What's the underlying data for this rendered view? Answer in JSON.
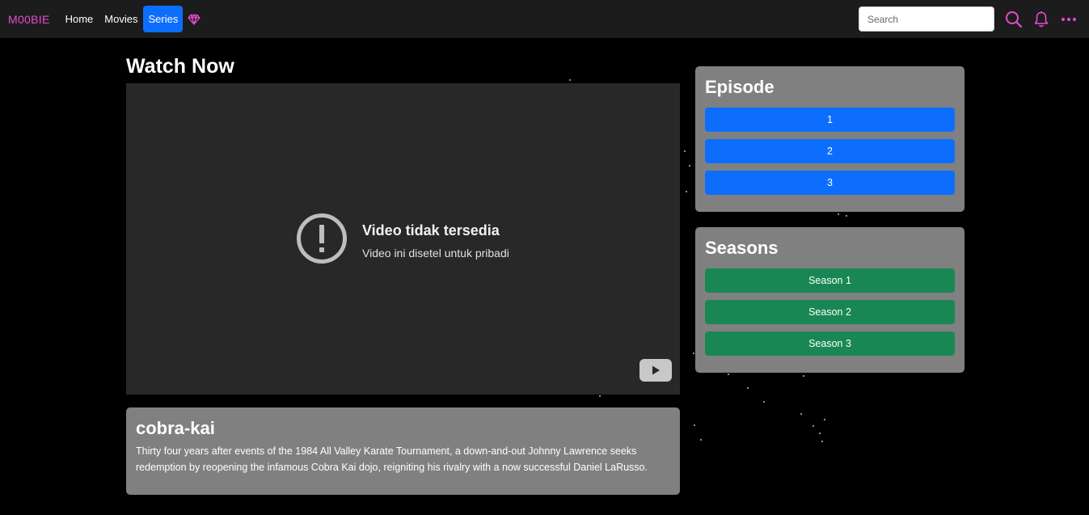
{
  "nav": {
    "brand": "M00BIE",
    "links": [
      "Home",
      "Movies",
      "Series"
    ],
    "search_placeholder": "Search"
  },
  "main": {
    "heading": "Watch Now",
    "video": {
      "error_title": "Video tidak tersedia",
      "error_sub": "Video ini disetel untuk pribadi"
    },
    "show": {
      "title": "cobra-kai",
      "description": "Thirty four years after events of the 1984 All Valley Karate Tournament, a down-and-out Johnny Lawrence seeks redemption by reopening the infamous Cobra Kai dojo, reigniting his rivalry with a now successful Daniel LaRusso."
    }
  },
  "episodes": {
    "title": "Episode",
    "items": [
      "1",
      "2",
      "3"
    ]
  },
  "seasons": {
    "title": "Seasons",
    "items": [
      "Season 1",
      "Season 2",
      "Season 3"
    ]
  },
  "colors": {
    "brand": "#e64bd0",
    "primary": "#0d6efd",
    "success": "#198754",
    "card": "#808080"
  }
}
